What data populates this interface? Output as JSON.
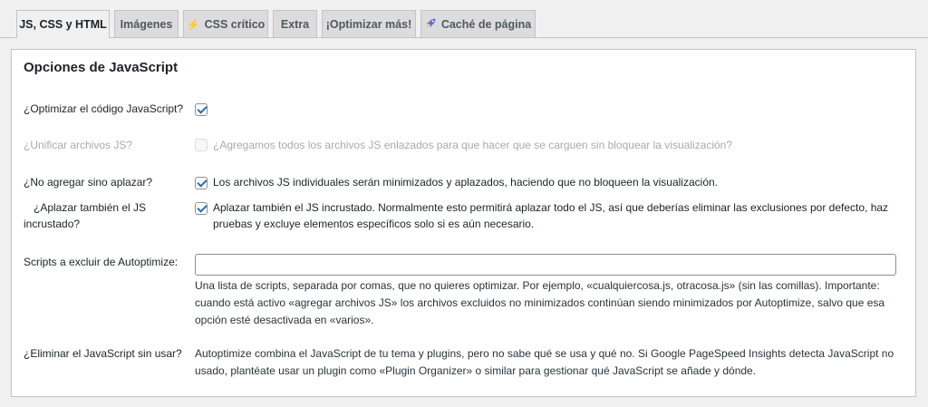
{
  "tabs": [
    {
      "label": "JS, CSS y HTML",
      "icon": "",
      "active": true
    },
    {
      "label": "Imágenes",
      "icon": "",
      "active": false
    },
    {
      "label": "CSS crítico",
      "icon": "lightning-icon",
      "active": false
    },
    {
      "label": "Extra",
      "icon": "",
      "active": false
    },
    {
      "label": "¡Optimizar más!",
      "icon": "",
      "active": false
    },
    {
      "label": "Caché de página",
      "icon": "rocket-icon",
      "active": false
    }
  ],
  "section_title": "Opciones de JavaScript",
  "rows": {
    "optimize": {
      "label": "¿Optimizar el código JavaScript?",
      "checked": true
    },
    "aggregate": {
      "label": "¿Unificar archivos JS?",
      "description": "¿Agregamos todos los archivos JS enlazados para que hacer que se carguen sin bloquear la visualización?",
      "checked": false,
      "disabled": true
    },
    "defer": {
      "label": "¿No agregar sino aplazar?",
      "description": "Los archivos JS individuales serán minimizados y aplazados, haciendo que no bloqueen la visualización.",
      "checked": true
    },
    "defer_inline": {
      "label_line1": "¿Aplazar también el JS",
      "label_line2": "incrustado?",
      "description_line1": "Aplazar también el JS incrustado. Normalmente esto permitirá aplazar todo el JS, así que deberías eliminar las exclusiones por defecto, haz",
      "description_line2": "pruebas y excluye elementos específicos solo si es aún necesario.",
      "checked": true
    },
    "exclude": {
      "label": "Scripts a excluir de Autoptimize:",
      "value": "",
      "help_line1": "Una lista de scripts, separada por comas, que no quieres optimizar. Por ejemplo, «cualquiercosa.js, otracosa.js» (sin las comillas). Importante:",
      "help_line2": "cuando está activo «agregar archivos JS» los archivos excluidos no minimizados continúan siendo minimizados por Autoptimize, salvo que esa",
      "help_line3": "opción esté desactivada en «varios»."
    },
    "unused": {
      "label": "¿Eliminar el JavaScript sin usar?",
      "text_line1": "Autoptimize combina el JavaScript de tu tema y plugins, pero no sabe qué se usa y qué no. Si Google PageSpeed Insights detecta JavaScript no",
      "text_line2": "usado, plantéate usar un plugin como «Plugin Organizer» o similar para gestionar qué JavaScript se añade y dónde."
    }
  },
  "colors": {
    "accent": "#2271b1",
    "tab_bg": "#dcdcde",
    "page_bg": "#f0f0f1",
    "border": "#c3c4c7"
  }
}
